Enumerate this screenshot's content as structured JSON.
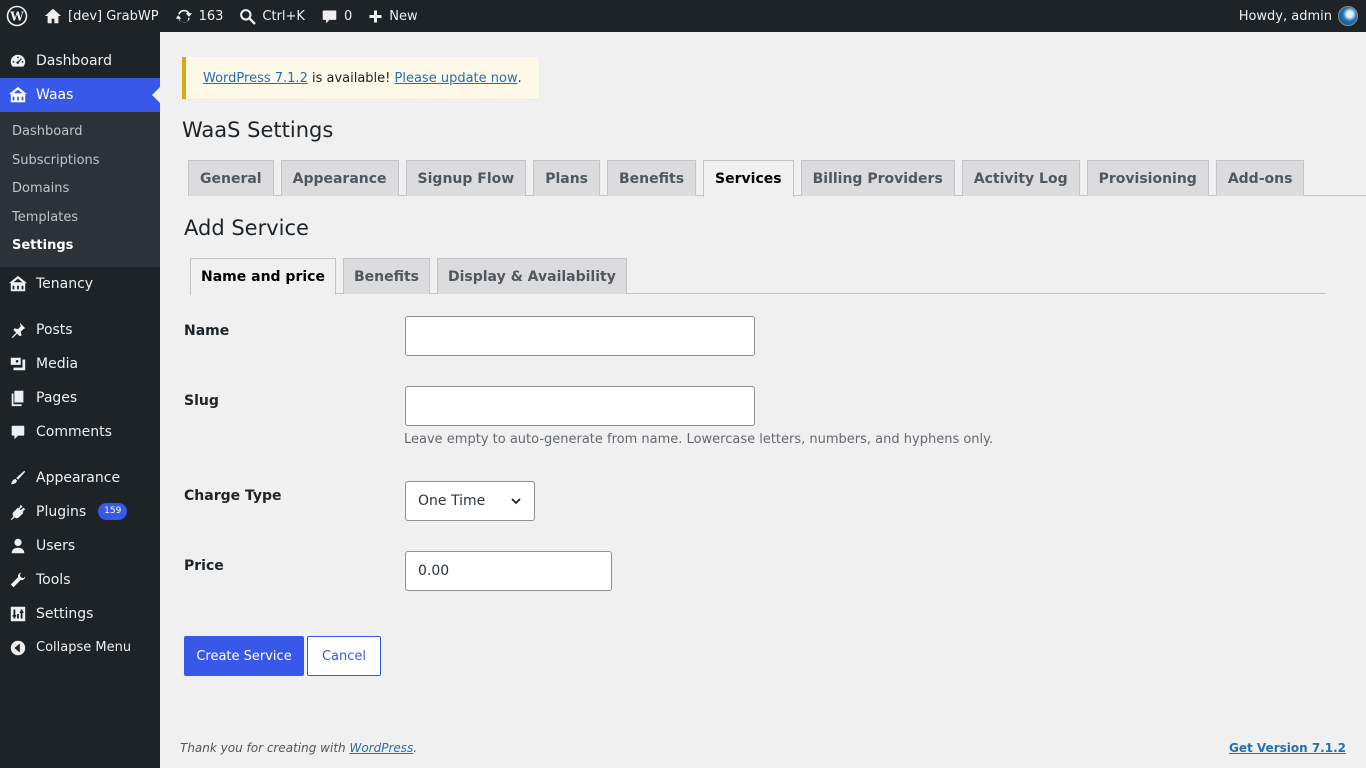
{
  "adminbar": {
    "site_name": "[dev] GrabWP",
    "updates_count": "163",
    "search_shortcut": "Ctrl+K",
    "comments_count": "0",
    "new_label": "New",
    "greeting": "Howdy, admin"
  },
  "sidebar": {
    "dashboard": "Dashboard",
    "waas": "Waas",
    "waas_sub": [
      "Dashboard",
      "Subscriptions",
      "Domains",
      "Templates",
      "Settings"
    ],
    "tenancy": "Tenancy",
    "posts": "Posts",
    "media": "Media",
    "pages": "Pages",
    "comments": "Comments",
    "appearance": "Appearance",
    "plugins": "Plugins",
    "plugins_badge": "159",
    "users": "Users",
    "tools": "Tools",
    "settings": "Settings",
    "collapse": "Collapse Menu"
  },
  "notice": {
    "link_version": "WordPress 7.1.2",
    "middle": " is available! ",
    "link_update": "Please update now",
    "end": "."
  },
  "page_title": "WaaS Settings",
  "nav_tabs": [
    "General",
    "Appearance",
    "Signup Flow",
    "Plans",
    "Benefits",
    "Services",
    "Billing Providers",
    "Activity Log",
    "Provisioning",
    "Add-ons"
  ],
  "active_nav_tab": "Services",
  "section_title": "Add Service",
  "sub_tabs": [
    "Name and price",
    "Benefits",
    "Display & Availability"
  ],
  "form": {
    "name_label": "Name",
    "name_value": "",
    "slug_label": "Slug",
    "slug_value": "",
    "slug_help": "Leave empty to auto-generate from name. Lowercase letters, numbers, and hyphens only.",
    "charge_type_label": "Charge Type",
    "charge_type_value": "One Time",
    "price_label": "Price",
    "price_value": "0.00",
    "create_button": "Create Service",
    "cancel_button": "Cancel"
  },
  "footer": {
    "thanks_prefix": "Thank you for creating with ",
    "thanks_link": "WordPress",
    "thanks_suffix": ".",
    "version_link": "Get Version 7.1.2"
  },
  "colors": {
    "admin_bg": "#1d2327",
    "accent": "#3858e9",
    "notice_border": "#dba617"
  }
}
